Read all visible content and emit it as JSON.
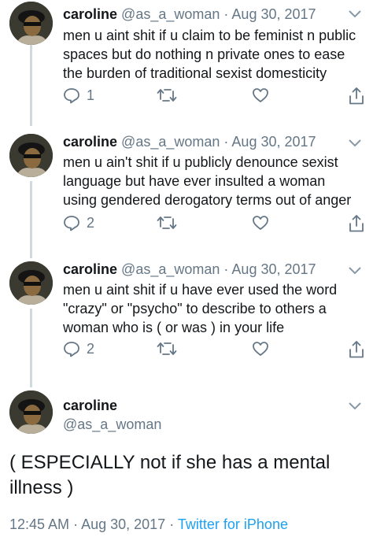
{
  "tweets": [
    {
      "name": "caroline",
      "handle": "@as_a_woman",
      "separator": "·",
      "date": "Aug 30, 2017",
      "lines": [
        "men u aint shit if u claim to be feminist n public",
        "spaces but do nothing n private ones to ease",
        "the burden of traditional sexist domesticity"
      ],
      "reply_count": "1"
    },
    {
      "name": "caroline",
      "handle": "@as_a_woman",
      "separator": "·",
      "date": "Aug 30, 2017",
      "lines": [
        "men u ain't shit if u publicly denounce sexist",
        "language but have ever insulted a woman",
        "using gendered derogatory terms out of anger"
      ],
      "reply_count": "2"
    },
    {
      "name": "caroline",
      "handle": "@as_a_woman",
      "separator": "·",
      "date": "Aug 30, 2017",
      "lines": [
        "men u aint shit if u have ever used the word",
        "\"crazy\" or \"psycho\" to describe to others a",
        "woman who is ( or was ) in your life"
      ],
      "reply_count": "2"
    }
  ],
  "main_tweet": {
    "name": "caroline",
    "handle": "@as_a_woman",
    "lines": [
      "( ESPECIALLY not if she has a mental",
      "illness )"
    ],
    "time": "12:45 AM",
    "separator": "·",
    "date": "Aug 30, 2017",
    "source": "Twitter for iPhone"
  },
  "icons": {
    "reply": "reply-icon",
    "retweet": "retweet-icon",
    "like": "heart-icon",
    "share": "share-icon",
    "more": "chevron-down-icon"
  },
  "colors": {
    "text": "#14171a",
    "secondary": "#657786",
    "link": "#1da1f2",
    "thread_line": "#cfd9de"
  }
}
